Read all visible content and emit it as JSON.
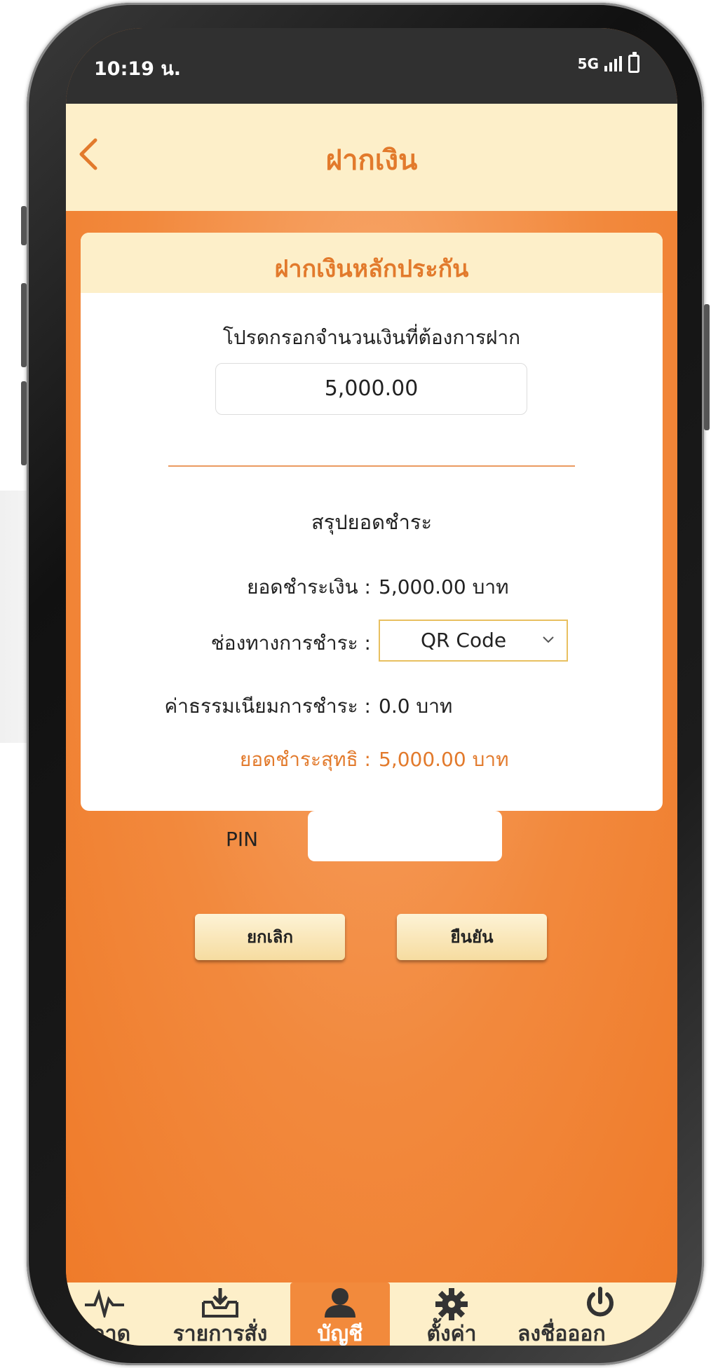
{
  "status_bar": {
    "time": "10:19 น.",
    "network": "5G"
  },
  "header": {
    "title": "ฝากเงิน",
    "back_icon": "chevron-left-icon"
  },
  "card": {
    "title": "ฝากเงินหลักประกัน",
    "prompt": "โปรดกรอกจำนวนเงินที่ต้องการฝาก",
    "amount_value": "5,000.00",
    "summary_title": "สรุปยอดชำระ",
    "rows": {
      "payment_amount_label": "ยอดชำระเงิน :",
      "payment_amount_value": "5,000.00 บาท",
      "channel_label": "ช่องทางการชำระ :",
      "channel_selected": "QR Code",
      "fee_label": "ค่าธรรมเนียมการชำระ :",
      "fee_value": "0.0 บาท",
      "net_label": "ยอดชำระสุทธิ :",
      "net_value": "5,000.00 บาท"
    }
  },
  "pin": {
    "label": "PIN",
    "value": ""
  },
  "buttons": {
    "cancel": "ยกเลิก",
    "confirm": "ยืนยัน"
  },
  "tabs": [
    {
      "label": "ตลาด",
      "icon": "pulse-icon"
    },
    {
      "label": "รายการสั่ง",
      "icon": "inbox-download-icon"
    },
    {
      "label": "บัญชี",
      "icon": "user-icon",
      "active": true
    },
    {
      "label": "ตั้งค่า",
      "icon": "gear-icon"
    },
    {
      "label": "ลงชื่อออก",
      "icon": "power-icon"
    }
  ],
  "colors": {
    "accent": "#f28a3c",
    "header_bg": "#fdefc9",
    "title_orange": "#e27a2c"
  }
}
